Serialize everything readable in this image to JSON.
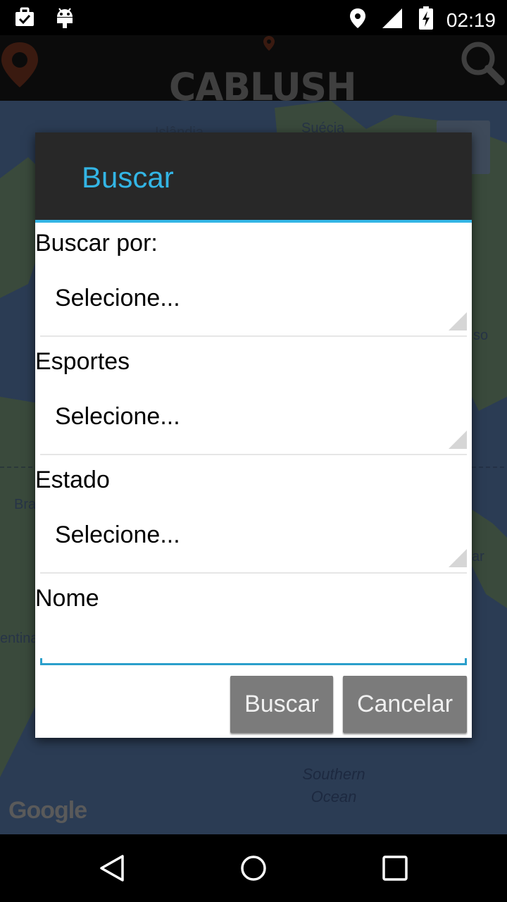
{
  "status_bar": {
    "time": "02:19",
    "icons": [
      "briefcase-check-icon",
      "android-icon",
      "location-pin-icon",
      "signal-icon",
      "battery-charging-icon"
    ]
  },
  "app_bar": {
    "logo_text": "CABLUSH",
    "icons": [
      "map-pin-icon",
      "search-icon"
    ]
  },
  "map": {
    "labels": {
      "islandia": "Islândia",
      "suecia": "Suécia",
      "brasil": "Bras",
      "argentina": "entina",
      "so": "so",
      "ar": "ar",
      "ocean_line1": "Southern",
      "ocean_line2": "Ocean"
    },
    "google_logo": "Google"
  },
  "dialog": {
    "title": "Buscar",
    "fields": [
      {
        "label": "Buscar por:",
        "value": "Selecione..."
      },
      {
        "label": "Esportes",
        "value": "Selecione..."
      },
      {
        "label": "Estado",
        "value": "Selecione..."
      }
    ],
    "nome_label": "Nome",
    "nome_value": "",
    "buttons": {
      "search": "Buscar",
      "cancel": "Cancelar"
    }
  },
  "nav_bar": {
    "icons": [
      "back-icon",
      "home-icon",
      "recents-icon"
    ]
  },
  "colors": {
    "accent": "#33b5e5",
    "dialog_header": "#282828",
    "button_bg": "#7b7b7b"
  }
}
